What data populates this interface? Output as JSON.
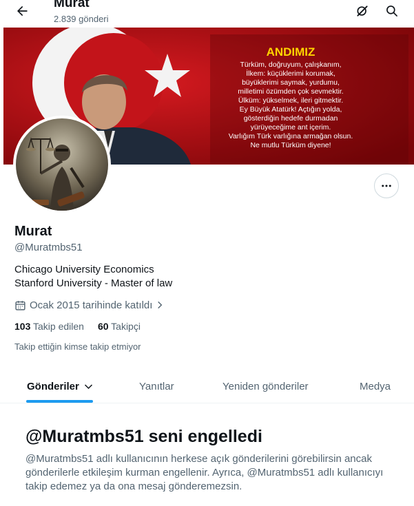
{
  "header": {
    "name": "Murat",
    "post_count": "2.839 gönderi",
    "icons": {
      "back": "arrow-left-icon",
      "grok": "grok-icon",
      "search": "search-icon"
    }
  },
  "banner": {
    "title": "ANDIMIZ",
    "lines": [
      "Türküm, doğruyum, çalışkanım,",
      "İlkem: küçüklerimi korumak,",
      "büyüklerimi saymak, yurdumu,",
      "milletimi özümden çok sevmektir.",
      "Ülküm: yükselmek, ileri gitmektir.",
      "Ey Büyük Atatürk! Açtığın yolda,",
      "gösterdiğin hedefe durmadan",
      "yürüyeceğime ant içerim.",
      "Varlığım Türk varlığına armağan olsun.",
      "Ne mutlu Türküm diyene!"
    ],
    "colors": {
      "flag_red": "#c8102e",
      "title": "#ffd400",
      "text": "#ffffff"
    }
  },
  "profile": {
    "name": "Murat",
    "handle": "@Muratmbs51",
    "bio_lines": [
      "Chicago University Economics",
      "Stanford University - Master of law"
    ],
    "joined": "Ocak 2015 tarihinde katıldı",
    "following_count": "103",
    "following_label": "Takip edilen",
    "followers_count": "60",
    "followers_label": "Takipçi",
    "followers_note": "Takip ettiğin kimse takip etmiyor"
  },
  "tabs": [
    {
      "label": "Gönderiler",
      "active": true
    },
    {
      "label": "Yanıtlar",
      "active": false
    },
    {
      "label": "Yeniden gönderiler",
      "active": false
    },
    {
      "label": "Medya",
      "active": false
    }
  ],
  "blocked": {
    "title": "@Muratmbs51 seni engelledi",
    "text": "@Muratmbs51 adlı kullanıcının herkese açık gönderilerini görebilirsin ancak gönderilerle etkileşim kurman engellenir. Ayrıca, @Muratmbs51 adlı kullanıcıyı takip edemez ya da ona mesaj gönderemezsin."
  },
  "accent_color": "#1d9bf0"
}
